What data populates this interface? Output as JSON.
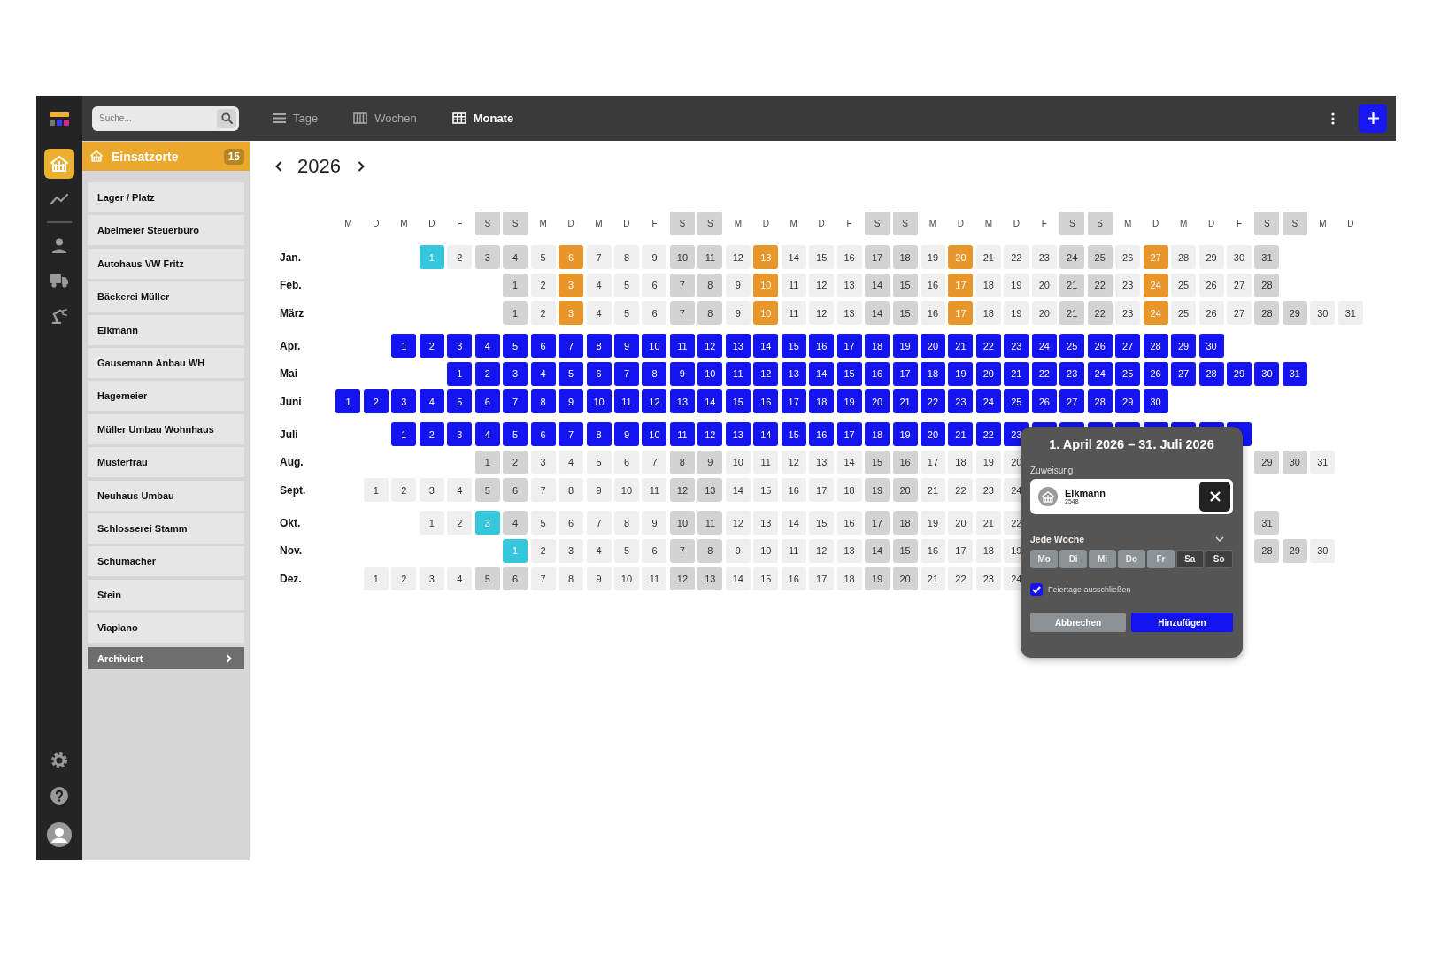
{
  "topbar": {
    "search": {
      "placeholder": "Suche..."
    },
    "views": [
      {
        "label": "Tage",
        "selected": false
      },
      {
        "label": "Wochen",
        "selected": false
      },
      {
        "label": "Monate",
        "selected": true
      }
    ]
  },
  "rail": [
    {
      "selected": true
    },
    {
      "selected": false
    },
    {
      "selected": false
    },
    {
      "selected": false
    },
    {
      "selected": false
    }
  ],
  "sidebar": {
    "title": "Einsatzorte",
    "count": "15",
    "items": [
      "Lager / Platz",
      "Abelmeier Steuerbüro",
      "Autohaus VW Fritz",
      "Bäckerei Müller",
      "Elkmann",
      "Gausemann Anbau WH",
      "Hagemeier",
      "Müller Umbau Wohnhaus",
      "Musterfrau",
      "Neuhaus Umbau",
      "Schlosserei Stamm",
      "Schumacher",
      "Stein",
      "Viaplano"
    ],
    "archive": "Archiviert"
  },
  "calendar": {
    "year": "2026",
    "weekdays": [
      {
        "label": "M",
        "kind": "weekday"
      },
      {
        "label": "D",
        "kind": "weekday"
      },
      {
        "label": "M",
        "kind": "weekday"
      },
      {
        "label": "D",
        "kind": "weekday"
      },
      {
        "label": "F",
        "kind": "weekday"
      },
      {
        "label": "S",
        "kind": "weekend"
      },
      {
        "label": "S",
        "kind": "weekend"
      },
      {
        "label": "M",
        "kind": "weekday"
      },
      {
        "label": "D",
        "kind": "weekday"
      },
      {
        "label": "M",
        "kind": "weekday"
      },
      {
        "label": "D",
        "kind": "weekday"
      },
      {
        "label": "F",
        "kind": "weekday"
      },
      {
        "label": "S",
        "kind": "weekend"
      },
      {
        "label": "S",
        "kind": "weekend"
      },
      {
        "label": "M",
        "kind": "weekday"
      },
      {
        "label": "D",
        "kind": "weekday"
      },
      {
        "label": "M",
        "kind": "weekday"
      },
      {
        "label": "D",
        "kind": "weekday"
      },
      {
        "label": "F",
        "kind": "weekday"
      },
      {
        "label": "S",
        "kind": "weekend"
      },
      {
        "label": "S",
        "kind": "weekend"
      },
      {
        "label": "M",
        "kind": "weekday"
      },
      {
        "label": "D",
        "kind": "weekday"
      },
      {
        "label": "M",
        "kind": "weekday"
      },
      {
        "label": "D",
        "kind": "weekday"
      },
      {
        "label": "F",
        "kind": "weekday"
      },
      {
        "label": "S",
        "kind": "weekend"
      },
      {
        "label": "S",
        "kind": "weekend"
      },
      {
        "label": "M",
        "kind": "weekday"
      },
      {
        "label": "D",
        "kind": "weekday"
      },
      {
        "label": "M",
        "kind": "weekday"
      },
      {
        "label": "D",
        "kind": "weekday"
      },
      {
        "label": "F",
        "kind": "weekday"
      },
      {
        "label": "S",
        "kind": "weekend"
      },
      {
        "label": "S",
        "kind": "weekend"
      },
      {
        "label": "M",
        "kind": "weekday"
      },
      {
        "label": "D",
        "kind": "weekday"
      }
    ],
    "months": [
      {
        "name": "Jan.",
        "days": [
          {
            "day": "1",
            "kind": "holiday"
          },
          {
            "day": "2",
            "kind": "day"
          },
          {
            "day": "3",
            "kind": "weekend"
          },
          {
            "day": "4",
            "kind": "weekend"
          },
          {
            "day": "5",
            "kind": "day"
          },
          {
            "day": "6",
            "kind": "booked"
          },
          {
            "day": "7",
            "kind": "day"
          },
          {
            "day": "8",
            "kind": "day"
          },
          {
            "day": "9",
            "kind": "day"
          },
          {
            "day": "10",
            "kind": "weekend"
          },
          {
            "day": "11",
            "kind": "weekend"
          },
          {
            "day": "12",
            "kind": "day"
          },
          {
            "day": "13",
            "kind": "booked"
          },
          {
            "day": "14",
            "kind": "day"
          },
          {
            "day": "15",
            "kind": "day"
          },
          {
            "day": "16",
            "kind": "day"
          },
          {
            "day": "17",
            "kind": "weekend"
          },
          {
            "day": "18",
            "kind": "weekend"
          },
          {
            "day": "19",
            "kind": "day"
          },
          {
            "day": "20",
            "kind": "booked"
          },
          {
            "day": "21",
            "kind": "day"
          },
          {
            "day": "22",
            "kind": "day"
          },
          {
            "day": "23",
            "kind": "day"
          },
          {
            "day": "24",
            "kind": "weekend"
          },
          {
            "day": "25",
            "kind": "weekend"
          },
          {
            "day": "26",
            "kind": "day"
          },
          {
            "day": "27",
            "kind": "booked"
          },
          {
            "day": "28",
            "kind": "day"
          },
          {
            "day": "29",
            "kind": "day"
          },
          {
            "day": "30",
            "kind": "day"
          },
          {
            "day": "31",
            "kind": "weekend"
          }
        ]
      },
      {
        "name": "Feb.",
        "days": [
          {
            "day": "1",
            "kind": "weekend"
          },
          {
            "day": "2",
            "kind": "day"
          },
          {
            "day": "3",
            "kind": "booked"
          },
          {
            "day": "4",
            "kind": "day"
          },
          {
            "day": "5",
            "kind": "day"
          },
          {
            "day": "6",
            "kind": "day"
          },
          {
            "day": "7",
            "kind": "weekend"
          },
          {
            "day": "8",
            "kind": "weekend"
          },
          {
            "day": "9",
            "kind": "day"
          },
          {
            "day": "10",
            "kind": "booked"
          },
          {
            "day": "11",
            "kind": "day"
          },
          {
            "day": "12",
            "kind": "day"
          },
          {
            "day": "13",
            "kind": "day"
          },
          {
            "day": "14",
            "kind": "weekend"
          },
          {
            "day": "15",
            "kind": "weekend"
          },
          {
            "day": "16",
            "kind": "day"
          },
          {
            "day": "17",
            "kind": "booked"
          },
          {
            "day": "18",
            "kind": "day"
          },
          {
            "day": "19",
            "kind": "day"
          },
          {
            "day": "20",
            "kind": "day"
          },
          {
            "day": "21",
            "kind": "weekend"
          },
          {
            "day": "22",
            "kind": "weekend"
          },
          {
            "day": "23",
            "kind": "day"
          },
          {
            "day": "24",
            "kind": "booked"
          },
          {
            "day": "25",
            "kind": "day"
          },
          {
            "day": "26",
            "kind": "day"
          },
          {
            "day": "27",
            "kind": "day"
          },
          {
            "day": "28",
            "kind": "weekend"
          }
        ]
      },
      {
        "name": "März",
        "days": [
          {
            "day": "1",
            "kind": "weekend"
          },
          {
            "day": "2",
            "kind": "day"
          },
          {
            "day": "3",
            "kind": "booked"
          },
          {
            "day": "4",
            "kind": "day"
          },
          {
            "day": "5",
            "kind": "day"
          },
          {
            "day": "6",
            "kind": "day"
          },
          {
            "day": "7",
            "kind": "weekend"
          },
          {
            "day": "8",
            "kind": "weekend"
          },
          {
            "day": "9",
            "kind": "day"
          },
          {
            "day": "10",
            "kind": "booked"
          },
          {
            "day": "11",
            "kind": "day"
          },
          {
            "day": "12",
            "kind": "day"
          },
          {
            "day": "13",
            "kind": "day"
          },
          {
            "day": "14",
            "kind": "weekend"
          },
          {
            "day": "15",
            "kind": "weekend"
          },
          {
            "day": "16",
            "kind": "day"
          },
          {
            "day": "17",
            "kind": "booked"
          },
          {
            "day": "18",
            "kind": "day"
          },
          {
            "day": "19",
            "kind": "day"
          },
          {
            "day": "20",
            "kind": "day"
          },
          {
            "day": "21",
            "kind": "weekend"
          },
          {
            "day": "22",
            "kind": "weekend"
          },
          {
            "day": "23",
            "kind": "day"
          },
          {
            "day": "24",
            "kind": "booked"
          },
          {
            "day": "25",
            "kind": "day"
          },
          {
            "day": "26",
            "kind": "day"
          },
          {
            "day": "27",
            "kind": "day"
          },
          {
            "day": "28",
            "kind": "weekend"
          },
          {
            "day": "29",
            "kind": "weekend"
          },
          {
            "day": "30",
            "kind": "day"
          },
          {
            "day": "31",
            "kind": "day"
          }
        ]
      },
      {
        "name": "Apr.",
        "days": [
          {
            "day": "1",
            "kind": "selected"
          },
          {
            "day": "2",
            "kind": "selected"
          },
          {
            "day": "3",
            "kind": "selected"
          },
          {
            "day": "4",
            "kind": "selected"
          },
          {
            "day": "5",
            "kind": "selected"
          },
          {
            "day": "6",
            "kind": "selected"
          },
          {
            "day": "7",
            "kind": "selected"
          },
          {
            "day": "8",
            "kind": "selected"
          },
          {
            "day": "9",
            "kind": "selected"
          },
          {
            "day": "10",
            "kind": "selected"
          },
          {
            "day": "11",
            "kind": "selected"
          },
          {
            "day": "12",
            "kind": "selected"
          },
          {
            "day": "13",
            "kind": "selected"
          },
          {
            "day": "14",
            "kind": "selected"
          },
          {
            "day": "15",
            "kind": "selected"
          },
          {
            "day": "16",
            "kind": "selected"
          },
          {
            "day": "17",
            "kind": "selected"
          },
          {
            "day": "18",
            "kind": "selected"
          },
          {
            "day": "19",
            "kind": "selected"
          },
          {
            "day": "20",
            "kind": "selected"
          },
          {
            "day": "21",
            "kind": "selected"
          },
          {
            "day": "22",
            "kind": "selected"
          },
          {
            "day": "23",
            "kind": "selected"
          },
          {
            "day": "24",
            "kind": "selected"
          },
          {
            "day": "25",
            "kind": "selected"
          },
          {
            "day": "26",
            "kind": "selected"
          },
          {
            "day": "27",
            "kind": "selected"
          },
          {
            "day": "28",
            "kind": "selected"
          },
          {
            "day": "29",
            "kind": "selected"
          },
          {
            "day": "30",
            "kind": "selected"
          }
        ]
      },
      {
        "name": "Mai",
        "days": [
          {
            "day": "1",
            "kind": "selected"
          },
          {
            "day": "2",
            "kind": "selected"
          },
          {
            "day": "3",
            "kind": "selected"
          },
          {
            "day": "4",
            "kind": "selected"
          },
          {
            "day": "5",
            "kind": "selected"
          },
          {
            "day": "6",
            "kind": "selected"
          },
          {
            "day": "7",
            "kind": "selected"
          },
          {
            "day": "8",
            "kind": "selected"
          },
          {
            "day": "9",
            "kind": "selected"
          },
          {
            "day": "10",
            "kind": "selected"
          },
          {
            "day": "11",
            "kind": "selected"
          },
          {
            "day": "12",
            "kind": "selected"
          },
          {
            "day": "13",
            "kind": "selected"
          },
          {
            "day": "14",
            "kind": "selected"
          },
          {
            "day": "15",
            "kind": "selected"
          },
          {
            "day": "16",
            "kind": "selected"
          },
          {
            "day": "17",
            "kind": "selected"
          },
          {
            "day": "18",
            "kind": "selected"
          },
          {
            "day": "19",
            "kind": "selected"
          },
          {
            "day": "20",
            "kind": "selected"
          },
          {
            "day": "21",
            "kind": "selected"
          },
          {
            "day": "22",
            "kind": "selected"
          },
          {
            "day": "23",
            "kind": "selected"
          },
          {
            "day": "24",
            "kind": "selected"
          },
          {
            "day": "25",
            "kind": "selected"
          },
          {
            "day": "26",
            "kind": "selected"
          },
          {
            "day": "27",
            "kind": "selected"
          },
          {
            "day": "28",
            "kind": "selected"
          },
          {
            "day": "29",
            "kind": "selected"
          },
          {
            "day": "30",
            "kind": "selected"
          },
          {
            "day": "31",
            "kind": "selected"
          }
        ]
      },
      {
        "name": "Juni",
        "days": [
          {
            "day": "1",
            "kind": "selected"
          },
          {
            "day": "2",
            "kind": "selected"
          },
          {
            "day": "3",
            "kind": "selected"
          },
          {
            "day": "4",
            "kind": "selected"
          },
          {
            "day": "5",
            "kind": "selected"
          },
          {
            "day": "6",
            "kind": "selected"
          },
          {
            "day": "7",
            "kind": "selected"
          },
          {
            "day": "8",
            "kind": "selected"
          },
          {
            "day": "9",
            "kind": "selected"
          },
          {
            "day": "10",
            "kind": "selected"
          },
          {
            "day": "11",
            "kind": "selected"
          },
          {
            "day": "12",
            "kind": "selected"
          },
          {
            "day": "13",
            "kind": "selected"
          },
          {
            "day": "14",
            "kind": "selected"
          },
          {
            "day": "15",
            "kind": "selected"
          },
          {
            "day": "16",
            "kind": "selected"
          },
          {
            "day": "17",
            "kind": "selected"
          },
          {
            "day": "18",
            "kind": "selected"
          },
          {
            "day": "19",
            "kind": "selected"
          },
          {
            "day": "20",
            "kind": "selected"
          },
          {
            "day": "21",
            "kind": "selected"
          },
          {
            "day": "22",
            "kind": "selected"
          },
          {
            "day": "23",
            "kind": "selected"
          },
          {
            "day": "24",
            "kind": "selected"
          },
          {
            "day": "25",
            "kind": "selected"
          },
          {
            "day": "26",
            "kind": "selected"
          },
          {
            "day": "27",
            "kind": "selected"
          },
          {
            "day": "28",
            "kind": "selected"
          },
          {
            "day": "29",
            "kind": "selected"
          },
          {
            "day": "30",
            "kind": "selected"
          }
        ]
      },
      {
        "name": "Juli",
        "days": [
          {
            "day": "1",
            "kind": "selected"
          },
          {
            "day": "2",
            "kind": "selected"
          },
          {
            "day": "3",
            "kind": "selected"
          },
          {
            "day": "4",
            "kind": "selected"
          },
          {
            "day": "5",
            "kind": "selected"
          },
          {
            "day": "6",
            "kind": "selected"
          },
          {
            "day": "7",
            "kind": "selected"
          },
          {
            "day": "8",
            "kind": "selected"
          },
          {
            "day": "9",
            "kind": "selected"
          },
          {
            "day": "10",
            "kind": "selected"
          },
          {
            "day": "11",
            "kind": "selected"
          },
          {
            "day": "12",
            "kind": "selected"
          },
          {
            "day": "13",
            "kind": "selected"
          },
          {
            "day": "14",
            "kind": "selected"
          },
          {
            "day": "15",
            "kind": "selected"
          },
          {
            "day": "16",
            "kind": "selected"
          },
          {
            "day": "17",
            "kind": "selected"
          },
          {
            "day": "18",
            "kind": "selected"
          },
          {
            "day": "19",
            "kind": "selected"
          },
          {
            "day": "20",
            "kind": "selected"
          },
          {
            "day": "21",
            "kind": "selected"
          },
          {
            "day": "22",
            "kind": "selected"
          },
          {
            "day": "23",
            "kind": "selected"
          },
          {
            "kind": "selected"
          },
          {
            "kind": "selected"
          },
          {
            "kind": "selected"
          },
          {
            "kind": "selected"
          },
          {
            "kind": "selected"
          },
          {
            "kind": "selected"
          },
          {
            "kind": "selected"
          },
          {
            "kind": "selected"
          }
        ]
      },
      {
        "name": "Aug.",
        "days": [
          {
            "day": "1",
            "kind": "weekend"
          },
          {
            "day": "2",
            "kind": "weekend"
          },
          {
            "day": "3",
            "kind": "day"
          },
          {
            "day": "4",
            "kind": "day"
          },
          {
            "day": "5",
            "kind": "day"
          },
          {
            "day": "6",
            "kind": "day"
          },
          {
            "day": "7",
            "kind": "day"
          },
          {
            "day": "8",
            "kind": "weekend"
          },
          {
            "day": "9",
            "kind": "weekend"
          },
          {
            "day": "10",
            "kind": "day"
          },
          {
            "day": "11",
            "kind": "day"
          },
          {
            "day": "12",
            "kind": "day"
          },
          {
            "day": "13",
            "kind": "day"
          },
          {
            "day": "14",
            "kind": "day"
          },
          {
            "day": "15",
            "kind": "weekend"
          },
          {
            "day": "16",
            "kind": "weekend"
          },
          {
            "day": "17",
            "kind": "day"
          },
          {
            "day": "18",
            "kind": "day"
          },
          {
            "day": "19",
            "kind": "day"
          },
          {
            "day": "20",
            "kind": "day"
          },
          {
            "kind": "covered"
          },
          {
            "kind": "covered"
          },
          {
            "kind": "covered"
          },
          {
            "kind": "covered"
          },
          {
            "kind": "covered"
          },
          {
            "kind": "covered"
          },
          {
            "kind": "covered"
          },
          {
            "kind": "covered"
          },
          {
            "day": "29",
            "kind": "weekend"
          },
          {
            "day": "30",
            "kind": "weekend"
          },
          {
            "day": "31",
            "kind": "day"
          }
        ]
      },
      {
        "name": "Sept.",
        "days": [
          {
            "day": "1",
            "kind": "day"
          },
          {
            "day": "2",
            "kind": "day"
          },
          {
            "day": "3",
            "kind": "day"
          },
          {
            "day": "4",
            "kind": "day"
          },
          {
            "day": "5",
            "kind": "weekend"
          },
          {
            "day": "6",
            "kind": "weekend"
          },
          {
            "day": "7",
            "kind": "day"
          },
          {
            "day": "8",
            "kind": "day"
          },
          {
            "day": "9",
            "kind": "day"
          },
          {
            "day": "10",
            "kind": "day"
          },
          {
            "day": "11",
            "kind": "day"
          },
          {
            "day": "12",
            "kind": "weekend"
          },
          {
            "day": "13",
            "kind": "weekend"
          },
          {
            "day": "14",
            "kind": "day"
          },
          {
            "day": "15",
            "kind": "day"
          },
          {
            "day": "16",
            "kind": "day"
          },
          {
            "day": "17",
            "kind": "day"
          },
          {
            "day": "18",
            "kind": "day"
          },
          {
            "day": "19",
            "kind": "weekend"
          },
          {
            "day": "20",
            "kind": "weekend"
          },
          {
            "day": "21",
            "kind": "day"
          },
          {
            "day": "22",
            "kind": "day"
          },
          {
            "day": "23",
            "kind": "day"
          },
          {
            "day": "24",
            "kind": "day"
          }
        ]
      },
      {
        "name": "Okt.",
        "days": [
          {
            "day": "1",
            "kind": "day"
          },
          {
            "day": "2",
            "kind": "day"
          },
          {
            "day": "3",
            "kind": "holiday"
          },
          {
            "day": "4",
            "kind": "weekend"
          },
          {
            "day": "5",
            "kind": "day"
          },
          {
            "day": "6",
            "kind": "day"
          },
          {
            "day": "7",
            "kind": "day"
          },
          {
            "day": "8",
            "kind": "day"
          },
          {
            "day": "9",
            "kind": "day"
          },
          {
            "day": "10",
            "kind": "weekend"
          },
          {
            "day": "11",
            "kind": "weekend"
          },
          {
            "day": "12",
            "kind": "day"
          },
          {
            "day": "13",
            "kind": "day"
          },
          {
            "day": "14",
            "kind": "day"
          },
          {
            "day": "15",
            "kind": "day"
          },
          {
            "day": "16",
            "kind": "day"
          },
          {
            "day": "17",
            "kind": "weekend"
          },
          {
            "day": "18",
            "kind": "weekend"
          },
          {
            "day": "19",
            "kind": "day"
          },
          {
            "day": "20",
            "kind": "day"
          },
          {
            "day": "21",
            "kind": "day"
          },
          {
            "day": "22",
            "kind": "day"
          },
          {
            "kind": "covered"
          },
          {
            "kind": "covered"
          },
          {
            "kind": "covered"
          },
          {
            "kind": "covered"
          },
          {
            "kind": "covered"
          },
          {
            "kind": "covered"
          },
          {
            "kind": "covered"
          },
          {
            "kind": "covered"
          },
          {
            "day": "31",
            "kind": "weekend"
          }
        ]
      },
      {
        "name": "Nov.",
        "days": [
          {
            "day": "1",
            "kind": "holiday"
          },
          {
            "day": "2",
            "kind": "day"
          },
          {
            "day": "3",
            "kind": "day"
          },
          {
            "day": "4",
            "kind": "day"
          },
          {
            "day": "5",
            "kind": "day"
          },
          {
            "day": "6",
            "kind": "day"
          },
          {
            "day": "7",
            "kind": "weekend"
          },
          {
            "day": "8",
            "kind": "weekend"
          },
          {
            "day": "9",
            "kind": "day"
          },
          {
            "day": "10",
            "kind": "day"
          },
          {
            "day": "11",
            "kind": "day"
          },
          {
            "day": "12",
            "kind": "day"
          },
          {
            "day": "13",
            "kind": "day"
          },
          {
            "day": "14",
            "kind": "weekend"
          },
          {
            "day": "15",
            "kind": "weekend"
          },
          {
            "day": "16",
            "kind": "day"
          },
          {
            "day": "17",
            "kind": "day"
          },
          {
            "day": "18",
            "kind": "day"
          },
          {
            "day": "19",
            "kind": "day"
          },
          {
            "kind": "covered"
          },
          {
            "kind": "covered"
          },
          {
            "kind": "covered"
          },
          {
            "kind": "covered"
          },
          {
            "kind": "covered"
          },
          {
            "kind": "covered"
          },
          {
            "kind": "covered"
          },
          {
            "kind": "covered"
          },
          {
            "day": "28",
            "kind": "weekend"
          },
          {
            "day": "29",
            "kind": "weekend"
          },
          {
            "day": "30",
            "kind": "day"
          }
        ]
      },
      {
        "name": "Dez.",
        "days": [
          {
            "day": "1",
            "kind": "day"
          },
          {
            "day": "2",
            "kind": "day"
          },
          {
            "day": "3",
            "kind": "day"
          },
          {
            "day": "4",
            "kind": "day"
          },
          {
            "day": "5",
            "kind": "weekend"
          },
          {
            "day": "6",
            "kind": "weekend"
          },
          {
            "day": "7",
            "kind": "day"
          },
          {
            "day": "8",
            "kind": "day"
          },
          {
            "day": "9",
            "kind": "day"
          },
          {
            "day": "10",
            "kind": "day"
          },
          {
            "day": "11",
            "kind": "day"
          },
          {
            "day": "12",
            "kind": "weekend"
          },
          {
            "day": "13",
            "kind": "weekend"
          },
          {
            "day": "14",
            "kind": "day"
          },
          {
            "day": "15",
            "kind": "day"
          },
          {
            "day": "16",
            "kind": "day"
          },
          {
            "day": "17",
            "kind": "day"
          },
          {
            "day": "18",
            "kind": "day"
          },
          {
            "day": "19",
            "kind": "weekend"
          },
          {
            "day": "20",
            "kind": "weekend"
          },
          {
            "day": "21",
            "kind": "day"
          },
          {
            "day": "22",
            "kind": "day"
          },
          {
            "day": "23",
            "kind": "day"
          },
          {
            "day": "24",
            "kind": "day"
          }
        ]
      }
    ]
  },
  "popup": {
    "title": "1. April 2026 – 31. Juli 2026",
    "assignment_label": "Zuweisung",
    "assignee": {
      "name": "Elkmann",
      "number": "2548"
    },
    "repeat": "Jede Woche",
    "weekdays": [
      {
        "label": "Mo",
        "selected": true
      },
      {
        "label": "Di",
        "selected": true
      },
      {
        "label": "Mi",
        "selected": true
      },
      {
        "label": "Do",
        "selected": true
      },
      {
        "label": "Fr",
        "selected": true
      },
      {
        "label": "Sa",
        "selected": false
      },
      {
        "label": "So",
        "selected": false
      }
    ],
    "exclude_holidays": {
      "label": "Feiertage ausschließen",
      "checked": true
    },
    "buttons": [
      {
        "label": "Abbrechen",
        "kind": "secondary"
      },
      {
        "label": "Hinzufügen",
        "kind": "primary"
      }
    ]
  }
}
